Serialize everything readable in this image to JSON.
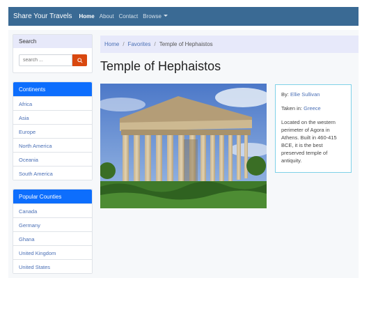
{
  "navbar": {
    "brand": "Share Your Travels",
    "links": [
      "Home",
      "About",
      "Contact",
      "Browse"
    ]
  },
  "search": {
    "heading": "Search",
    "placeholder": "search ..."
  },
  "continents": {
    "heading": "Continents",
    "items": [
      "Africa",
      "Asia",
      "Europe",
      "North America",
      "Oceania",
      "South America"
    ]
  },
  "countries": {
    "heading": "Popular Counties",
    "items": [
      "Canada",
      "Germany",
      "Ghana",
      "United Kingdom",
      "United States"
    ]
  },
  "breadcrumb": {
    "items": [
      "Home",
      "Favorites",
      "Temple of Hephaistos"
    ]
  },
  "photo": {
    "title": "Temple of Hephaistos",
    "by_label": "By:",
    "author": "Ellie Sullivan",
    "taken_label": "Taken in:",
    "country": "Greece",
    "description": "Located on the western perimeter of Agora in Athens. Built in 460-415 BCE, it is the best preserved temple of antiquity."
  },
  "colors": {
    "navbar": "#3a6a94",
    "accent": "#0d6efd",
    "search_button": "#d9480f",
    "link": "#4a6fb5"
  }
}
